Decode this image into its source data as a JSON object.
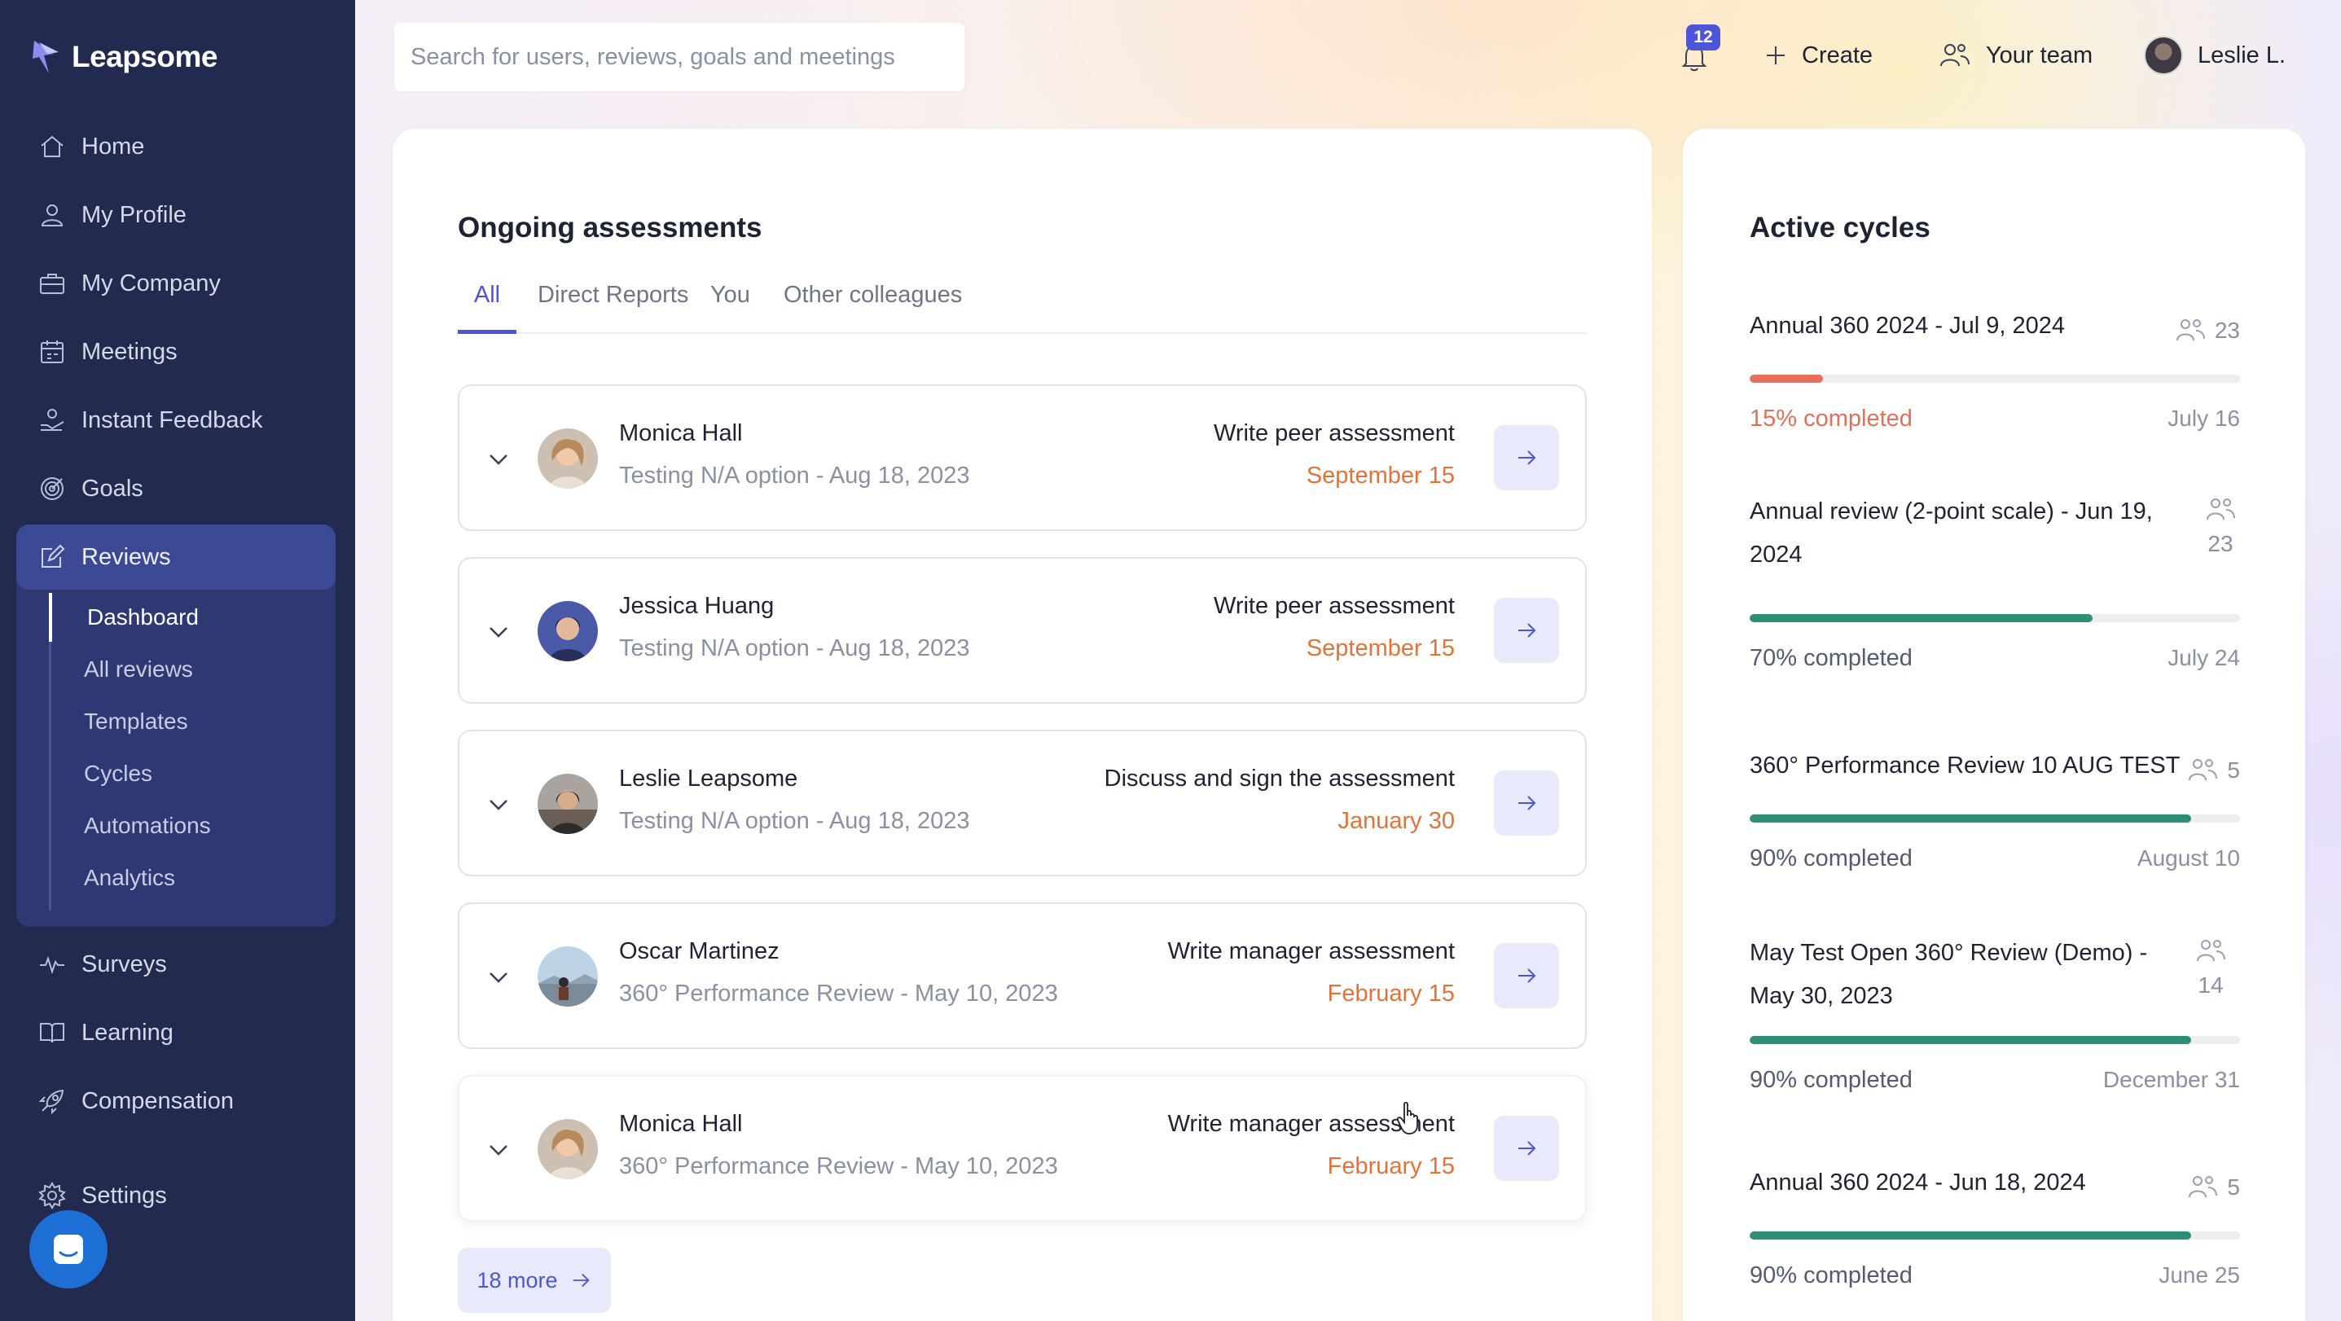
{
  "app": {
    "name": "Leapsome"
  },
  "sidebar": {
    "items": [
      {
        "label": "Home",
        "icon": "home-icon"
      },
      {
        "label": "My Profile",
        "icon": "user-icon"
      },
      {
        "label": "My Company",
        "icon": "briefcase-icon"
      },
      {
        "label": "Meetings",
        "icon": "calendar-icon"
      },
      {
        "label": "Instant Feedback",
        "icon": "feedback-icon"
      },
      {
        "label": "Goals",
        "icon": "target-icon"
      },
      {
        "label": "Reviews",
        "icon": "edit-icon"
      },
      {
        "label": "Surveys",
        "icon": "pulse-icon"
      },
      {
        "label": "Learning",
        "icon": "book-icon"
      },
      {
        "label": "Compensation",
        "icon": "rocket-icon"
      },
      {
        "label": "Settings",
        "icon": "gear-icon"
      }
    ],
    "reviews_sub": [
      "Dashboard",
      "All reviews",
      "Templates",
      "Cycles",
      "Automations",
      "Analytics"
    ],
    "active_sub": "Dashboard"
  },
  "topbar": {
    "search_placeholder": "Search for users, reviews, goals and meetings",
    "notifications": "12",
    "create_label": "Create",
    "team_label": "Your team",
    "user_label": "Leslie L."
  },
  "assessments": {
    "title": "Ongoing assessments",
    "tabs": [
      "All",
      "Direct Reports",
      "You",
      "Other colleagues"
    ],
    "active_tab": "All",
    "rows": [
      {
        "name": "Monica Hall",
        "subtitle": "Testing N/A option - Aug 18, 2023",
        "action": "Write peer assessment",
        "due": "September 15"
      },
      {
        "name": "Jessica Huang",
        "subtitle": "Testing N/A option - Aug 18, 2023",
        "action": "Write peer assessment",
        "due": "September 15"
      },
      {
        "name": "Leslie Leapsome",
        "subtitle": "Testing N/A option - Aug 18, 2023",
        "action": "Discuss and sign the assessment",
        "due": "January 30"
      },
      {
        "name": "Oscar Martinez",
        "subtitle": "360° Performance Review - May 10, 2023",
        "action": "Write manager assessment",
        "due": "February 15"
      },
      {
        "name": "Monica Hall",
        "subtitle": "360° Performance Review - May 10, 2023",
        "action": "Write manager assessment",
        "due": "February 15"
      }
    ],
    "more_label": "18 more"
  },
  "cycles": {
    "title": "Active cycles",
    "items": [
      {
        "title": "Annual 360 2024 - Jul 9, 2024",
        "participants": "23",
        "progress": 0.15,
        "progress_label": "15% completed",
        "date": "July 16",
        "color": "#e8705a"
      },
      {
        "title": "Annual review (2-point scale) - Jun 19, 2024",
        "participants": "23",
        "progress": 0.7,
        "progress_label": "70% completed",
        "date": "July 24",
        "color": "#2f8f76"
      },
      {
        "title": "360° Performance Review 10 AUG TEST",
        "participants": "5",
        "progress": 0.9,
        "progress_label": "90% completed",
        "date": "August 10",
        "color": "#2f8f76"
      },
      {
        "title": "May Test Open 360° Review (Demo) - May 30, 2023",
        "participants": "14",
        "progress": 0.9,
        "progress_label": "90% completed",
        "date": "December 31",
        "color": "#2f8f76"
      },
      {
        "title": "Annual 360 2024 - Jun 18, 2024",
        "participants": "5",
        "progress": 0.9,
        "progress_label": "90% completed",
        "date": "June 25",
        "color": "#2f8f76"
      }
    ]
  },
  "colors": {
    "accent": "#4c55d8",
    "sidebar": "#232a4f",
    "due": "#e0733a"
  }
}
